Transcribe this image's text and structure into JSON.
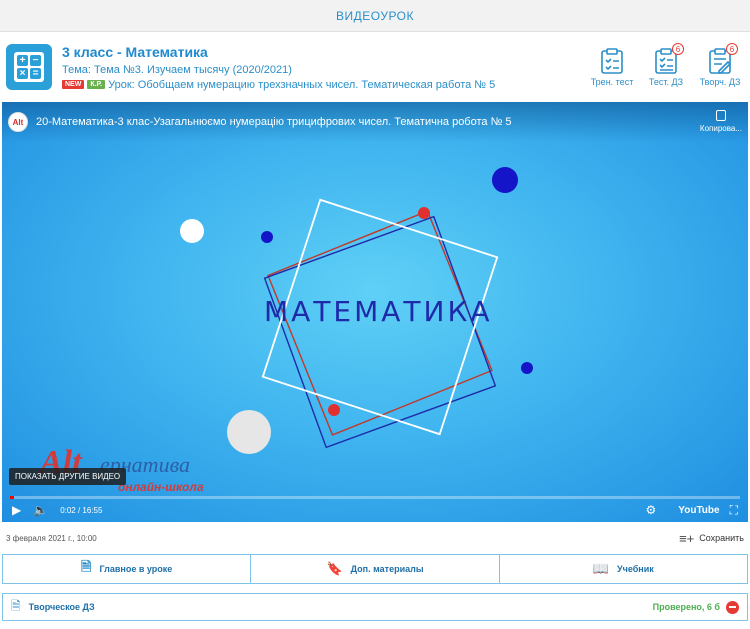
{
  "topbar": {
    "title": "ВИДЕОУРОК"
  },
  "header": {
    "title": "3 класс - Математика",
    "theme": "Тема: Тема №3. Изучаем тысячу (2020/2021)",
    "badge_new": "NEW",
    "badge_kr": "К.Р.",
    "lesson": "Урок: Обобщаем нумерацию трехзначных чисел. Тематическая работа № 5"
  },
  "actions": [
    {
      "label": "Трен. тест",
      "icon": "clipboard-check-icon",
      "count": ""
    },
    {
      "label": "Тест. ДЗ",
      "icon": "clipboard-list-icon",
      "count": "6"
    },
    {
      "label": "Творч. ДЗ",
      "icon": "clipboard-pen-icon",
      "count": "6"
    }
  ],
  "video": {
    "channel_icon": "Alt",
    "title": "20-Математика-3 клас-Узагальнюємо нумерацію трицифрових чисел. Тематична робота № 5",
    "copy_label": "Копирова...",
    "overlay_word": "МАТЕМАТИКА",
    "watermark_alt": "Alt",
    "watermark_rest": "ернатива",
    "watermark_sub": "онлайн-школа",
    "show_other_label": "ПОКАЗАТЬ ДРУГИЕ ВИДЕО",
    "time": "0:02 / 16:55",
    "progress": 0.002,
    "youtube_label": "YouTube"
  },
  "meta": {
    "date": "3 февраля 2021 г., 10:00",
    "save_label": "Сохранить"
  },
  "tabs": [
    {
      "label": "Главное в уроке",
      "icon": "document-icon"
    },
    {
      "label": "Доп. материалы",
      "icon": "bookmark-icon"
    },
    {
      "label": "Учебник",
      "icon": "book-icon"
    }
  ],
  "homework": {
    "title": "Творческое ДЗ",
    "status": "Проверено, 6 б"
  },
  "colors": {
    "accent": "#2a8fc9",
    "video_bg": "#3fb4ef",
    "danger": "#e53935",
    "success": "#4caf50"
  }
}
